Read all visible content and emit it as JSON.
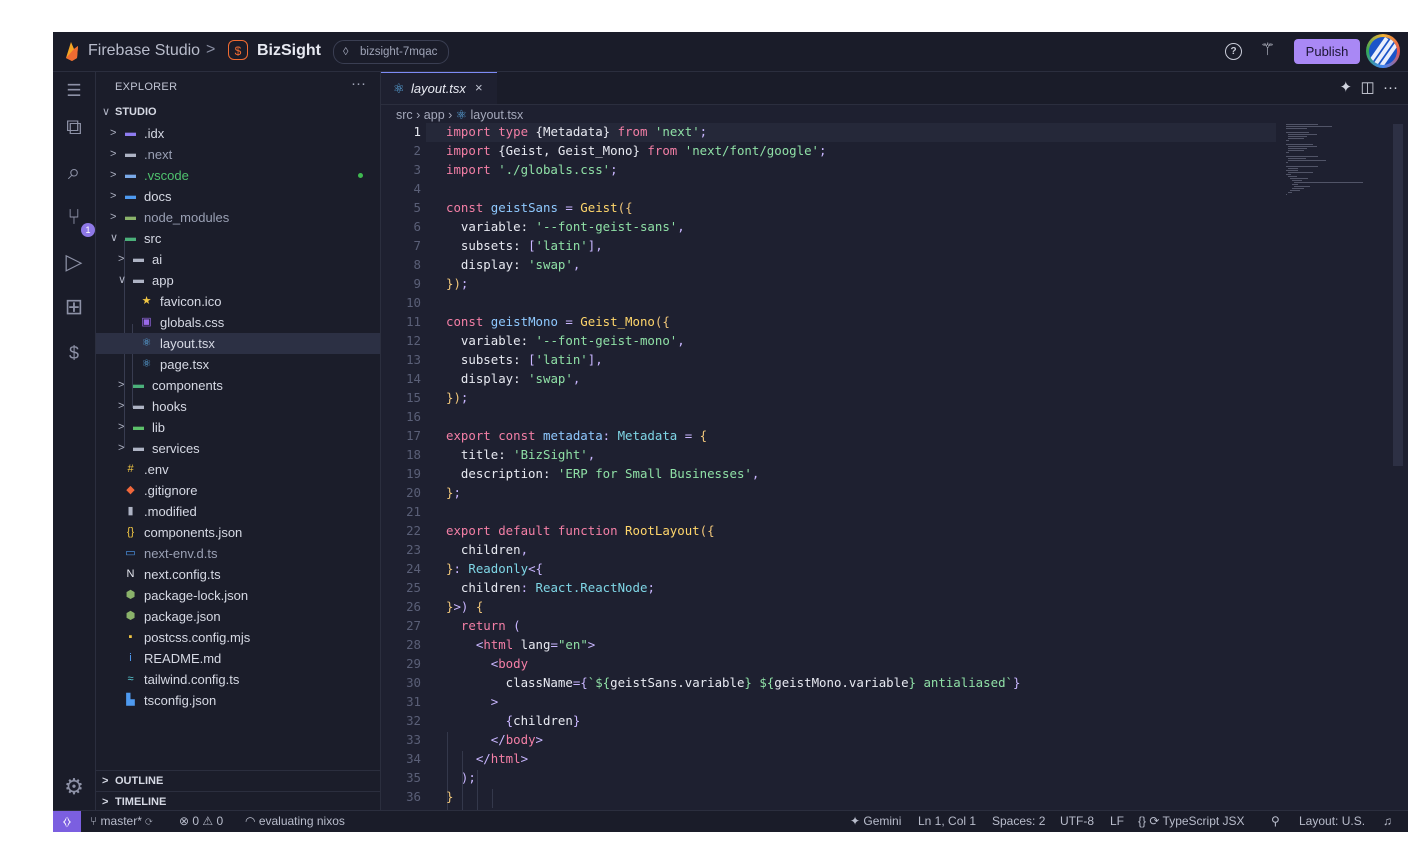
{
  "titlebar": {
    "brand": "Firebase Studio",
    "separator": ">",
    "project": "BizSight",
    "workspace": "bizsight-7mqac",
    "publish_label": "Publish"
  },
  "explorer": {
    "title": "EXPLORER",
    "more": "···",
    "rows": [
      {
        "label": "STUDIO",
        "depth": 0,
        "kind": "folder-open",
        "icon": "chevron-down-icon",
        "root": true
      },
      {
        "label": ".idx",
        "depth": 1,
        "kind": "folder",
        "icon": "idx-folder-icon",
        "color": "#8e7cf0"
      },
      {
        "label": ".next",
        "depth": 1,
        "kind": "folder",
        "icon": "folder-icon",
        "color": "#aeb3c4",
        "dim": true
      },
      {
        "label": ".vscode",
        "depth": 1,
        "kind": "folder",
        "icon": "vscode-folder-icon",
        "color": "#7aa9e8",
        "modified": true
      },
      {
        "label": "docs",
        "depth": 1,
        "kind": "folder",
        "icon": "docs-folder-icon",
        "color": "#4e9af0"
      },
      {
        "label": "node_modules",
        "depth": 1,
        "kind": "folder",
        "icon": "node-modules-folder-icon",
        "color": "#8ab26a",
        "dim": true
      },
      {
        "label": "src",
        "depth": 1,
        "kind": "folder-open",
        "icon": "src-folder-icon",
        "color": "#4bb07a"
      },
      {
        "label": "ai",
        "depth": 2,
        "kind": "folder",
        "icon": "folder-icon",
        "color": "#aeb3c4"
      },
      {
        "label": "app",
        "depth": 2,
        "kind": "folder-open",
        "icon": "folder-icon",
        "color": "#aeb3c4"
      },
      {
        "label": "favicon.ico",
        "depth": 3,
        "kind": "file",
        "icon": "star-icon",
        "color": "#f2c744"
      },
      {
        "label": "globals.css",
        "depth": 3,
        "kind": "file",
        "icon": "css-icon",
        "color": "#9a6ae8"
      },
      {
        "label": "layout.tsx",
        "depth": 3,
        "kind": "file",
        "icon": "react-icon",
        "color": "#5fb4f0",
        "selected": true
      },
      {
        "label": "page.tsx",
        "depth": 3,
        "kind": "file",
        "icon": "react-icon",
        "color": "#5fb4f0"
      },
      {
        "label": "components",
        "depth": 2,
        "kind": "folder",
        "icon": "components-folder-icon",
        "color": "#4bb07a"
      },
      {
        "label": "hooks",
        "depth": 2,
        "kind": "folder",
        "icon": "folder-icon",
        "color": "#aeb3c4"
      },
      {
        "label": "lib",
        "depth": 2,
        "kind": "folder",
        "icon": "lib-folder-icon",
        "color": "#5cc06a"
      },
      {
        "label": "services",
        "depth": 2,
        "kind": "folder",
        "icon": "services-folder-icon",
        "color": "#aeb3c4"
      },
      {
        "label": ".env",
        "depth": 1,
        "kind": "file",
        "icon": "env-icon",
        "color": "#f2c744"
      },
      {
        "label": ".gitignore",
        "depth": 1,
        "kind": "file",
        "icon": "git-icon",
        "color": "#f0673b"
      },
      {
        "label": ".modified",
        "depth": 1,
        "kind": "file",
        "icon": "file-icon",
        "color": "#aeb3c4"
      },
      {
        "label": "components.json",
        "depth": 1,
        "kind": "file",
        "icon": "json-icon",
        "color": "#f2c744"
      },
      {
        "label": "next-env.d.ts",
        "depth": 1,
        "kind": "file",
        "icon": "ts-icon",
        "color": "#4e9af0",
        "dim": true
      },
      {
        "label": "next.config.ts",
        "depth": 1,
        "kind": "file",
        "icon": "next-icon",
        "color": "#e6e8f0"
      },
      {
        "label": "package-lock.json",
        "depth": 1,
        "kind": "file",
        "icon": "npm-icon",
        "color": "#8ab26a"
      },
      {
        "label": "package.json",
        "depth": 1,
        "kind": "file",
        "icon": "npm-icon",
        "color": "#8ab26a"
      },
      {
        "label": "postcss.config.mjs",
        "depth": 1,
        "kind": "file",
        "icon": "js-icon",
        "color": "#f2c744"
      },
      {
        "label": "README.md",
        "depth": 1,
        "kind": "file",
        "icon": "info-icon",
        "color": "#4e9af0"
      },
      {
        "label": "tailwind.config.ts",
        "depth": 1,
        "kind": "file",
        "icon": "tailwind-icon",
        "color": "#5ad0d8"
      },
      {
        "label": "tsconfig.json",
        "depth": 1,
        "kind": "file",
        "icon": "tsconfig-icon",
        "color": "#4e9af0"
      }
    ],
    "outline_label": "OUTLINE",
    "timeline_label": "TIMELINE"
  },
  "editor": {
    "tab_label": "layout.tsx",
    "tab_close": "×",
    "breadcrumb": [
      "src",
      "app",
      "layout.tsx"
    ],
    "current_line": 1,
    "code": [
      [
        [
          "k",
          "import type "
        ],
        [
          "b",
          "{Metadata}"
        ],
        [
          "k",
          " from "
        ],
        [
          "s",
          "'next'"
        ],
        [
          "p",
          ";"
        ]
      ],
      [
        [
          "k",
          "import "
        ],
        [
          "b",
          "{Geist, Geist_Mono}"
        ],
        [
          "k",
          " from "
        ],
        [
          "s",
          "'next/font/google'"
        ],
        [
          "p",
          ";"
        ]
      ],
      [
        [
          "k",
          "import "
        ],
        [
          "s",
          "'./globals.css'"
        ],
        [
          "p",
          ";"
        ]
      ],
      [],
      [
        [
          "k",
          "const "
        ],
        [
          "v",
          "geistSans "
        ],
        [
          "p",
          "= "
        ],
        [
          "f",
          "Geist"
        ],
        [
          "br",
          "({"
        ]
      ],
      [
        [
          "b",
          "  variable: "
        ],
        [
          "s",
          "'--font-geist-sans'"
        ],
        [
          "p",
          ","
        ]
      ],
      [
        [
          "b",
          "  subsets: "
        ],
        [
          "p",
          "["
        ],
        [
          "s",
          "'latin'"
        ],
        [
          "p",
          "],"
        ]
      ],
      [
        [
          "b",
          "  display: "
        ],
        [
          "s",
          "'swap'"
        ],
        [
          "p",
          ","
        ]
      ],
      [
        [
          "br",
          "})"
        ],
        [
          "p",
          ";"
        ]
      ],
      [],
      [
        [
          "k",
          "const "
        ],
        [
          "v",
          "geistMono "
        ],
        [
          "p",
          "= "
        ],
        [
          "f",
          "Geist_Mono"
        ],
        [
          "br",
          "({"
        ]
      ],
      [
        [
          "b",
          "  variable: "
        ],
        [
          "s",
          "'--font-geist-mono'"
        ],
        [
          "p",
          ","
        ]
      ],
      [
        [
          "b",
          "  subsets: "
        ],
        [
          "p",
          "["
        ],
        [
          "s",
          "'latin'"
        ],
        [
          "p",
          "],"
        ]
      ],
      [
        [
          "b",
          "  display: "
        ],
        [
          "s",
          "'swap'"
        ],
        [
          "p",
          ","
        ]
      ],
      [
        [
          "br",
          "})"
        ],
        [
          "p",
          ";"
        ]
      ],
      [],
      [
        [
          "k",
          "export const "
        ],
        [
          "v",
          "metadata"
        ],
        [
          "p",
          ": "
        ],
        [
          "t",
          "Metadata "
        ],
        [
          "p",
          "= "
        ],
        [
          "br",
          "{"
        ]
      ],
      [
        [
          "b",
          "  title: "
        ],
        [
          "s",
          "'BizSight'"
        ],
        [
          "p",
          ","
        ]
      ],
      [
        [
          "b",
          "  description: "
        ],
        [
          "s",
          "'ERP for Small Businesses'"
        ],
        [
          "p",
          ","
        ]
      ],
      [
        [
          "br",
          "}"
        ],
        [
          "p",
          ";"
        ]
      ],
      [],
      [
        [
          "k",
          "export default function "
        ],
        [
          "f",
          "RootLayout"
        ],
        [
          "br",
          "({"
        ]
      ],
      [
        [
          "b",
          "  children"
        ],
        [
          "p",
          ","
        ]
      ],
      [
        [
          "br",
          "}"
        ],
        [
          "p",
          ": "
        ],
        [
          "t",
          "Readonly"
        ],
        [
          "p",
          "<{"
        ]
      ],
      [
        [
          "b",
          "  children"
        ],
        [
          "p",
          ": "
        ],
        [
          "t",
          "React.ReactNode"
        ],
        [
          "p",
          ";"
        ]
      ],
      [
        [
          "br",
          "}"
        ],
        [
          "p",
          ">) "
        ],
        [
          "br",
          "{"
        ]
      ],
      [
        [
          "k",
          "  return "
        ],
        [
          "p",
          "("
        ]
      ],
      [
        [
          "p",
          "    <"
        ],
        [
          "tag",
          "html "
        ],
        [
          "b",
          "lang"
        ],
        [
          "p",
          "="
        ],
        [
          "s",
          "\"en\""
        ],
        [
          "p",
          ">"
        ]
      ],
      [
        [
          "p",
          "      <"
        ],
        [
          "tag",
          "body"
        ]
      ],
      [
        [
          "b",
          "        className"
        ],
        [
          "p",
          "={"
        ],
        [
          "s",
          "`${"
        ],
        [
          "b",
          "geistSans.variable"
        ],
        [
          "s",
          "} ${"
        ],
        [
          "b",
          "geistMono.variable"
        ],
        [
          "s",
          "} antialiased`"
        ],
        [
          "p",
          "}"
        ]
      ],
      [
        [
          "p",
          "      >"
        ]
      ],
      [
        [
          "p",
          "        {"
        ],
        [
          "b",
          "children"
        ],
        [
          "p",
          "}"
        ]
      ],
      [
        [
          "p",
          "      </"
        ],
        [
          "tag",
          "body"
        ],
        [
          "p",
          ">"
        ]
      ],
      [
        [
          "p",
          "    </"
        ],
        [
          "tag",
          "html"
        ],
        [
          "p",
          ">"
        ]
      ],
      [
        [
          "p",
          "  );"
        ]
      ],
      [
        [
          "br",
          "}"
        ]
      ]
    ]
  },
  "statusbar": {
    "remote_icon": "remote-icon",
    "branch": "master*",
    "problems": "⊗ 0 ⚠ 0",
    "task": "evaluating nixos",
    "gemini": "Gemini",
    "position": "Ln 1, Col 1",
    "spaces": "Spaces: 2",
    "encoding": "UTF-8",
    "eol": "LF",
    "language": "TypeScript JSX",
    "layout": "Layout: U.S."
  },
  "colors": {
    "accent": "#a988f5",
    "background": "#1e2030",
    "keyword": "#f47fa6",
    "string": "#8fe0a6",
    "function": "#ffd66b"
  }
}
